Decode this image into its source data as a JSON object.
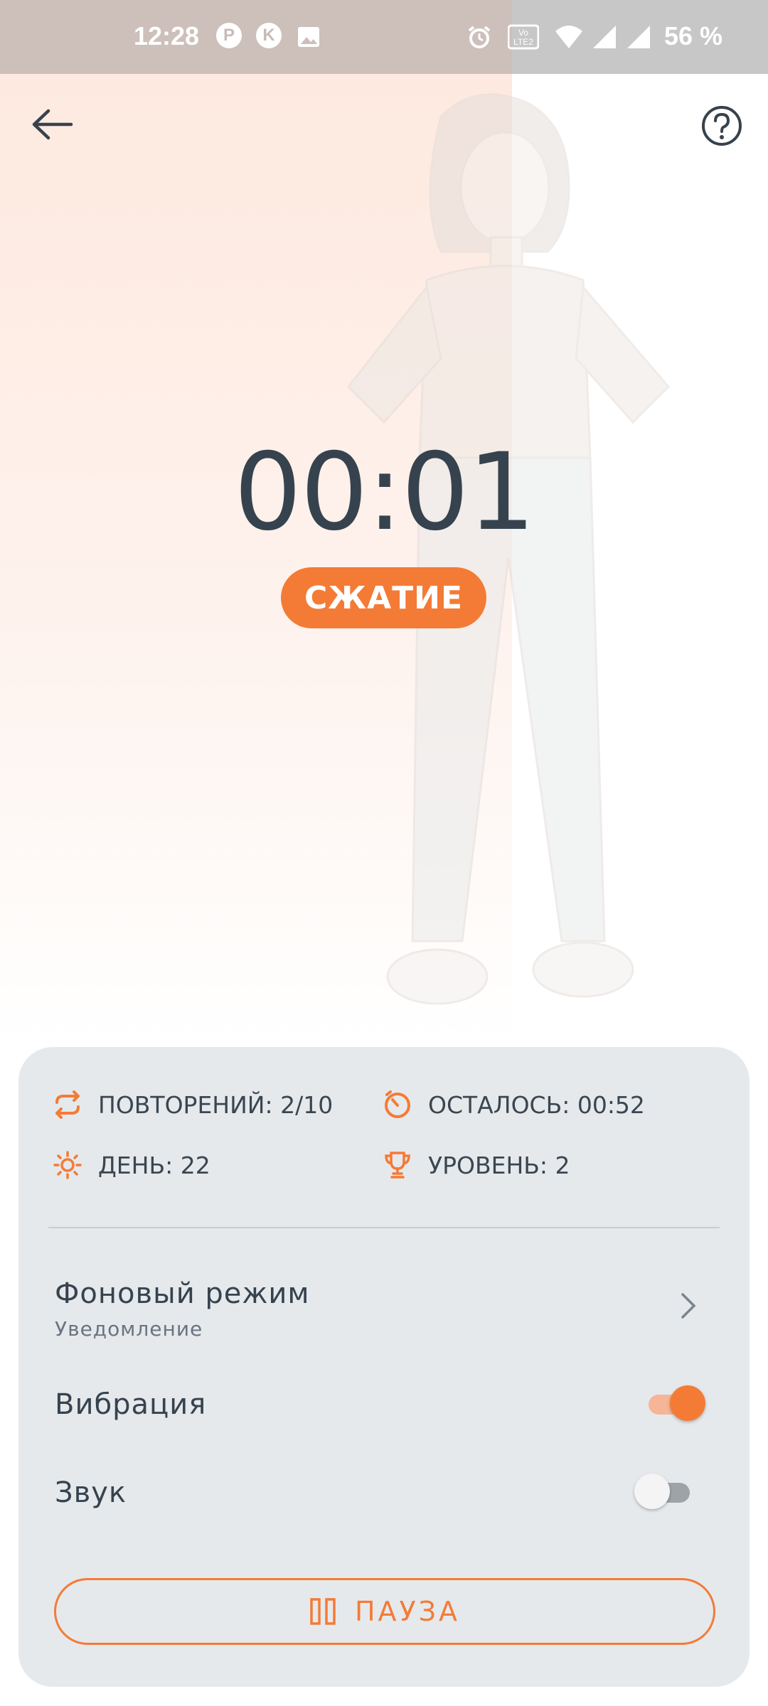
{
  "status_bar": {
    "time": "12:28",
    "battery": "56 %",
    "icons": [
      "p-circle-icon",
      "k-circle-icon",
      "image-icon",
      "alarm-icon",
      "volte-icon",
      "wifi-icon",
      "signal-r-icon",
      "signal-x-icon"
    ],
    "p_letter": "P",
    "k_letter": "K"
  },
  "header": {
    "back_icon": "arrow-left-icon",
    "help_icon": "question-circle-icon"
  },
  "timer": {
    "value": "00:01",
    "phase": "СЖАТИЕ"
  },
  "stats": {
    "repeats": "ПОВТОРЕНИЙ: 2/10",
    "remaining": "ОСТАЛОСЬ: 00:52",
    "day": "ДЕНЬ: 22",
    "level": "УРОВЕНЬ: 2"
  },
  "settings": {
    "background_mode": {
      "title": "Фоновый режим",
      "subtitle": "Уведомление"
    },
    "vibration": {
      "title": "Вибрация",
      "enabled": true
    },
    "sound": {
      "title": "Звук",
      "enabled": false
    }
  },
  "pause_button": {
    "label": "ПАУЗА"
  },
  "colors": {
    "accent": "#f47b36",
    "text_dark": "#36434f",
    "card_bg": "#e6e9ec"
  }
}
